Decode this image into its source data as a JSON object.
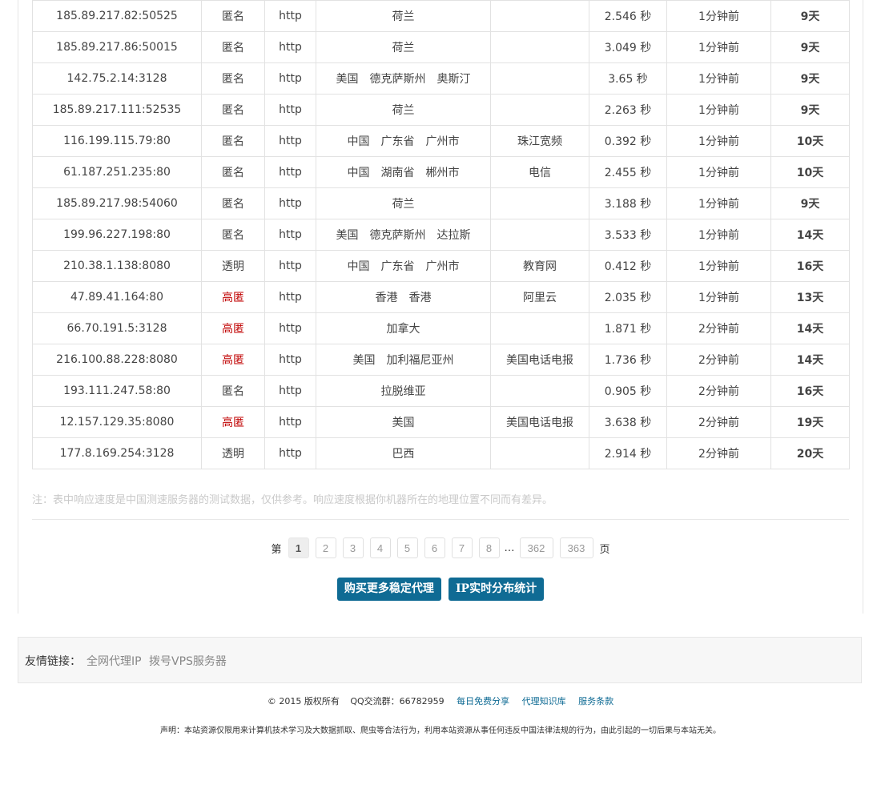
{
  "rows": [
    {
      "ip": "185.89.217.82:50525",
      "type": "匿名",
      "proto": "http",
      "loc": "荷兰",
      "isp": "",
      "speed": "2.546 秒",
      "checked": "1分钟前",
      "days": "9天"
    },
    {
      "ip": "185.89.217.86:50015",
      "type": "匿名",
      "proto": "http",
      "loc": "荷兰",
      "isp": "",
      "speed": "3.049 秒",
      "checked": "1分钟前",
      "days": "9天"
    },
    {
      "ip": "142.75.2.14:3128",
      "type": "匿名",
      "proto": "http",
      "loc": "美国　德克萨斯州　奥斯汀",
      "isp": "",
      "speed": "3.65 秒",
      "checked": "1分钟前",
      "days": "9天"
    },
    {
      "ip": "185.89.217.111:52535",
      "type": "匿名",
      "proto": "http",
      "loc": "荷兰",
      "isp": "",
      "speed": "2.263 秒",
      "checked": "1分钟前",
      "days": "9天"
    },
    {
      "ip": "116.199.115.79:80",
      "type": "匿名",
      "proto": "http",
      "loc": "中国　广东省　广州市",
      "isp": "珠江宽频",
      "speed": "0.392 秒",
      "checked": "1分钟前",
      "days": "10天"
    },
    {
      "ip": "61.187.251.235:80",
      "type": "匿名",
      "proto": "http",
      "loc": "中国　湖南省　郴州市",
      "isp": "电信",
      "speed": "2.455 秒",
      "checked": "1分钟前",
      "days": "10天"
    },
    {
      "ip": "185.89.217.98:54060",
      "type": "匿名",
      "proto": "http",
      "loc": "荷兰",
      "isp": "",
      "speed": "3.188 秒",
      "checked": "1分钟前",
      "days": "9天"
    },
    {
      "ip": "199.96.227.198:80",
      "type": "匿名",
      "proto": "http",
      "loc": "美国　德克萨斯州　达拉斯",
      "isp": "",
      "speed": "3.533 秒",
      "checked": "1分钟前",
      "days": "14天"
    },
    {
      "ip": "210.38.1.138:8080",
      "type": "透明",
      "proto": "http",
      "loc": "中国　广东省　广州市",
      "isp": "教育网",
      "speed": "0.412 秒",
      "checked": "1分钟前",
      "days": "16天"
    },
    {
      "ip": "47.89.41.164:80",
      "type": "高匿",
      "proto": "http",
      "loc": "香港　香港",
      "isp": "阿里云",
      "speed": "2.035 秒",
      "checked": "1分钟前",
      "days": "13天"
    },
    {
      "ip": "66.70.191.5:3128",
      "type": "高匿",
      "proto": "http",
      "loc": "加拿大",
      "isp": "",
      "speed": "1.871 秒",
      "checked": "2分钟前",
      "days": "14天"
    },
    {
      "ip": "216.100.88.228:8080",
      "type": "高匿",
      "proto": "http",
      "loc": "美国　加利福尼亚州",
      "isp": "美国电话电报",
      "speed": "1.736 秒",
      "checked": "2分钟前",
      "days": "14天"
    },
    {
      "ip": "193.111.247.58:80",
      "type": "匿名",
      "proto": "http",
      "loc": "拉脱维亚",
      "isp": "",
      "speed": "0.905 秒",
      "checked": "2分钟前",
      "days": "16天"
    },
    {
      "ip": "12.157.129.35:8080",
      "type": "高匿",
      "proto": "http",
      "loc": "美国",
      "isp": "美国电话电报",
      "speed": "3.638 秒",
      "checked": "2分钟前",
      "days": "19天"
    },
    {
      "ip": "177.8.169.254:3128",
      "type": "透明",
      "proto": "http",
      "loc": "巴西",
      "isp": "",
      "speed": "2.914 秒",
      "checked": "2分钟前",
      "days": "20天"
    }
  ],
  "note": "注：表中响应速度是中国测速服务器的测试数据，仅供参考。响应速度根据你机器所在的地理位置不同而有差异。",
  "pagination": {
    "prefix": "第",
    "suffix": "页",
    "current": "1",
    "pages": [
      "2",
      "3",
      "4",
      "5",
      "6",
      "7",
      "8"
    ],
    "ellipsis": "…",
    "last_pages": [
      "362",
      "363"
    ]
  },
  "buttons": {
    "buy": "购买更多稳定代理",
    "stats": "IP实时分布统计"
  },
  "friend_links": {
    "label": "友情链接：",
    "items": [
      "全网代理IP",
      "拨号VPS服务器"
    ]
  },
  "footer": {
    "copyright": "© 2015 版权所有",
    "qq": "QQ交流群：66782959",
    "links": [
      "每日免费分享",
      "代理知识库",
      "服务条款"
    ]
  },
  "disclaimer": "声明：本站资源仅限用来计算机技术学习及大数据抓取、爬虫等合法行为，利用本站资源从事任何违反中国法律法规的行为，由此引起的一切后果与本站无关。",
  "colors": {
    "high_anon": "#c00000",
    "days": "#0a8a0a",
    "button": "#0f6b94"
  }
}
